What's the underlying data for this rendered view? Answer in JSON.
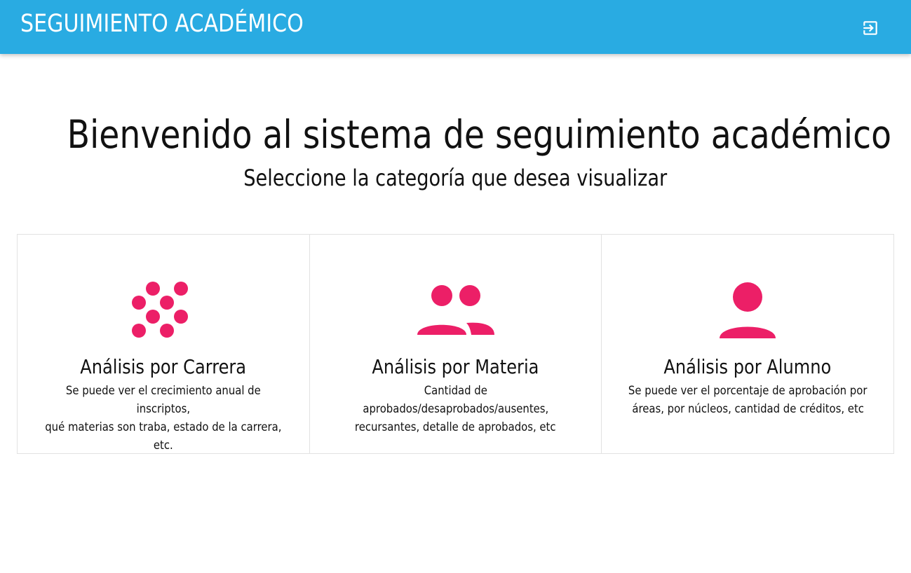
{
  "header": {
    "title": "SEGUIMIENTO ACADÉMICO",
    "logout_icon": "logout-icon",
    "bg_color": "#29abe2"
  },
  "hero": {
    "title": "Bienvenido al sistema de seguimiento académico",
    "subtitle": "Seleccione la categoría que desea visualizar"
  },
  "accent_color": "#ec1f67",
  "cards": [
    {
      "icon": "dots-grid-icon",
      "title": "Análisis por Carrera",
      "description_line1": "Se puede ver el crecimiento anual de inscriptos,",
      "description_line2": "qué materias son traba, estado de la carrera, etc."
    },
    {
      "icon": "group-icon",
      "title": "Análisis por Materia",
      "description_line1": "Cantidad de aprobados/desaprobados/ausentes,",
      "description_line2": "recursantes, detalle de aprobados, etc"
    },
    {
      "icon": "person-icon",
      "title": "Análisis por Alumno",
      "description_line1": "Se puede ver el porcentaje de aprobación por",
      "description_line2": "áreas, por núcleos, cantidad de créditos, etc"
    }
  ]
}
